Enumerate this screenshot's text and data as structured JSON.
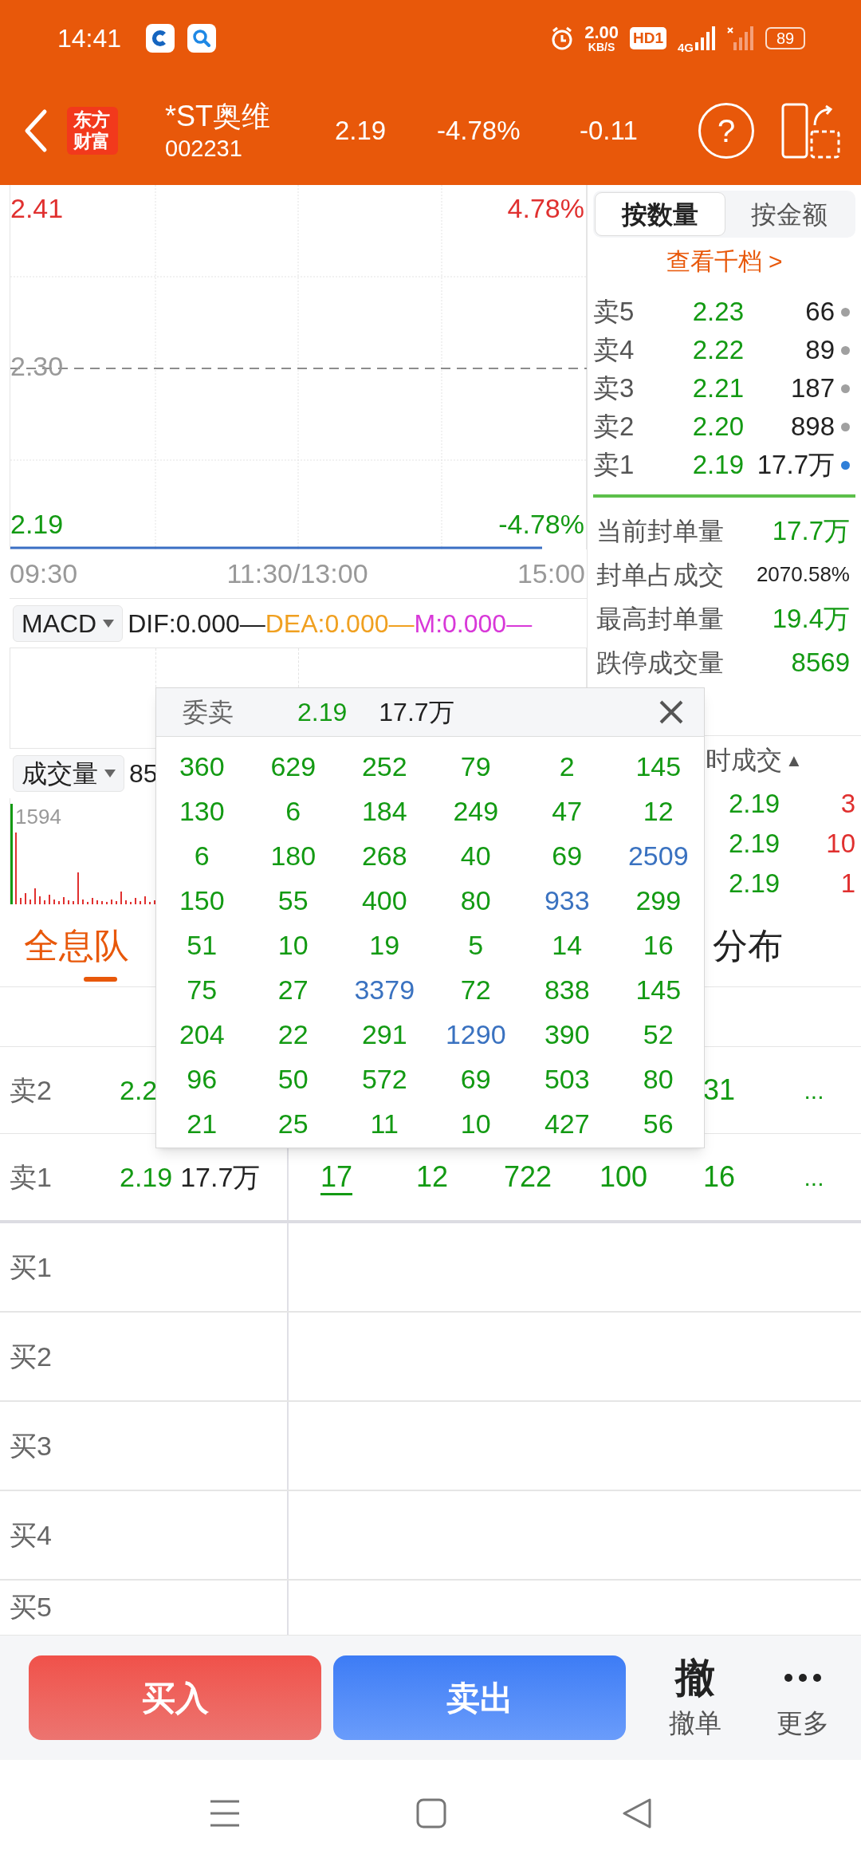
{
  "status_bar": {
    "time": "14:41",
    "speed": "2.00",
    "speed_unit": "KB/S",
    "hd": "HD1",
    "network": "4G",
    "battery": "89"
  },
  "header": {
    "logo": "东方财富",
    "name": "*ST奥维",
    "code": "002231",
    "price": "2.19",
    "change_pct": "-4.78%",
    "change": "-0.11",
    "help": "?"
  },
  "chart": {
    "high": "2.41",
    "high_pct": "4.78%",
    "mid": "2.30",
    "low": "2.19",
    "low_pct": "-4.78%",
    "times": [
      "09:30",
      "11:30/13:00",
      "15:00"
    ]
  },
  "macd": {
    "selector": "MACD",
    "dif": "DIF:0.000—",
    "dea": "DEA:0.000—",
    "m": "M:0.000—"
  },
  "volume": {
    "selector": "成交量",
    "value": "85",
    "max": "1594"
  },
  "book": {
    "tabs": [
      {
        "label": "按数量",
        "selected": true
      },
      {
        "label": "按金额",
        "selected": false
      }
    ],
    "link": "查看千档 >",
    "asks": [
      {
        "label": "卖5",
        "price": "2.23",
        "qty": "66",
        "color": "#a0a0a0"
      },
      {
        "label": "卖4",
        "price": "2.22",
        "qty": "89",
        "color": "#a0a0a0"
      },
      {
        "label": "卖3",
        "price": "2.21",
        "qty": "187",
        "color": "#a0a0a0"
      },
      {
        "label": "卖2",
        "price": "2.20",
        "qty": "898",
        "color": "#a0a0a0"
      },
      {
        "label": "卖1",
        "price": "2.19",
        "qty": "17.7万",
        "color": "#2f7fd8"
      }
    ],
    "stats": [
      {
        "label": "当前封单量",
        "value": "17.7万",
        "kind": "amount"
      },
      {
        "label": "封单占成交",
        "value": "2070.58%",
        "kind": "ratio"
      },
      {
        "label": "最高封单量",
        "value": "19.4万",
        "kind": "amount"
      },
      {
        "label": "跌停成交量",
        "value": "8569",
        "kind": "amount"
      }
    ]
  },
  "trades": {
    "header": "时成交",
    "sort": "▲",
    "rows": [
      {
        "price": "2.19",
        "qty": "3"
      },
      {
        "price": "2.19",
        "qty": "10"
      },
      {
        "price": "2.19",
        "qty": "1"
      }
    ]
  },
  "queue_tabs": [
    {
      "label": "全息队",
      "selected": true
    },
    {
      "label": "分布",
      "selected": false
    }
  ],
  "queue": [
    {
      "label": "卖2",
      "price": "2.2",
      "orders": [
        {
          "text": "31",
          "underlined": false
        }
      ],
      "more": "..."
    },
    {
      "label": "卖1",
      "price": "2.19",
      "amount": "17.7万",
      "orders": [
        {
          "text": "17",
          "underlined": true
        },
        {
          "text": "12",
          "underlined": false
        },
        {
          "text": "722",
          "underlined": false
        },
        {
          "text": "100",
          "underlined": false
        },
        {
          "text": "16",
          "underlined": false
        }
      ],
      "more": "..."
    },
    {
      "label": "买1"
    },
    {
      "label": "买2"
    },
    {
      "label": "买3"
    },
    {
      "label": "买4"
    },
    {
      "label": "买5"
    }
  ],
  "popup": {
    "title": "委卖",
    "price": "2.19",
    "amount": "17.7万",
    "rows": [
      [
        {
          "t": "360",
          "color": "#139a13"
        },
        {
          "t": "629",
          "color": "#139a13"
        },
        {
          "t": "252",
          "color": "#139a13"
        },
        {
          "t": "79",
          "color": "#139a13"
        },
        {
          "t": "2",
          "color": "#139a13"
        },
        {
          "t": "145",
          "color": "#139a13"
        }
      ],
      [
        {
          "t": "130",
          "color": "#139a13"
        },
        {
          "t": "6",
          "color": "#139a13"
        },
        {
          "t": "184",
          "color": "#139a13"
        },
        {
          "t": "249",
          "color": "#139a13"
        },
        {
          "t": "47",
          "color": "#139a13"
        },
        {
          "t": "12",
          "color": "#139a13"
        }
      ],
      [
        {
          "t": "6",
          "color": "#139a13"
        },
        {
          "t": "180",
          "color": "#139a13"
        },
        {
          "t": "268",
          "color": "#139a13"
        },
        {
          "t": "40",
          "color": "#139a13"
        },
        {
          "t": "69",
          "color": "#139a13"
        },
        {
          "t": "2509",
          "color": "#3a72c0"
        }
      ],
      [
        {
          "t": "150",
          "color": "#139a13"
        },
        {
          "t": "55",
          "color": "#139a13"
        },
        {
          "t": "400",
          "color": "#139a13"
        },
        {
          "t": "80",
          "color": "#139a13"
        },
        {
          "t": "933",
          "color": "#3a72c0"
        },
        {
          "t": "299",
          "color": "#139a13"
        }
      ],
      [
        {
          "t": "51",
          "color": "#139a13"
        },
        {
          "t": "10",
          "color": "#139a13"
        },
        {
          "t": "19",
          "color": "#139a13"
        },
        {
          "t": "5",
          "color": "#139a13"
        },
        {
          "t": "14",
          "color": "#139a13"
        },
        {
          "t": "16",
          "color": "#139a13"
        }
      ],
      [
        {
          "t": "75",
          "color": "#139a13"
        },
        {
          "t": "27",
          "color": "#139a13"
        },
        {
          "t": "3379",
          "color": "#3a72c0"
        },
        {
          "t": "72",
          "color": "#139a13"
        },
        {
          "t": "838",
          "color": "#139a13"
        },
        {
          "t": "145",
          "color": "#139a13"
        }
      ],
      [
        {
          "t": "204",
          "color": "#139a13"
        },
        {
          "t": "22",
          "color": "#139a13"
        },
        {
          "t": "291",
          "color": "#139a13"
        },
        {
          "t": "1290",
          "color": "#3a72c0"
        },
        {
          "t": "390",
          "color": "#139a13"
        },
        {
          "t": "52",
          "color": "#139a13"
        }
      ],
      [
        {
          "t": "96",
          "color": "#139a13"
        },
        {
          "t": "50",
          "color": "#139a13"
        },
        {
          "t": "572",
          "color": "#139a13"
        },
        {
          "t": "69",
          "color": "#139a13"
        },
        {
          "t": "503",
          "color": "#139a13"
        },
        {
          "t": "80",
          "color": "#139a13"
        }
      ],
      [
        {
          "t": "21",
          "color": "#139a13"
        },
        {
          "t": "25",
          "color": "#139a13"
        },
        {
          "t": "11",
          "color": "#139a13"
        },
        {
          "t": "10",
          "color": "#139a13"
        },
        {
          "t": "427",
          "color": "#139a13"
        },
        {
          "t": "56",
          "color": "#139a13"
        }
      ]
    ]
  },
  "actions": {
    "buy": "买入",
    "sell": "卖出",
    "items": [
      {
        "kind": "glyph",
        "glyph": "撤",
        "label": "撤单"
      },
      {
        "kind": "dots",
        "label": "更多"
      }
    ]
  }
}
